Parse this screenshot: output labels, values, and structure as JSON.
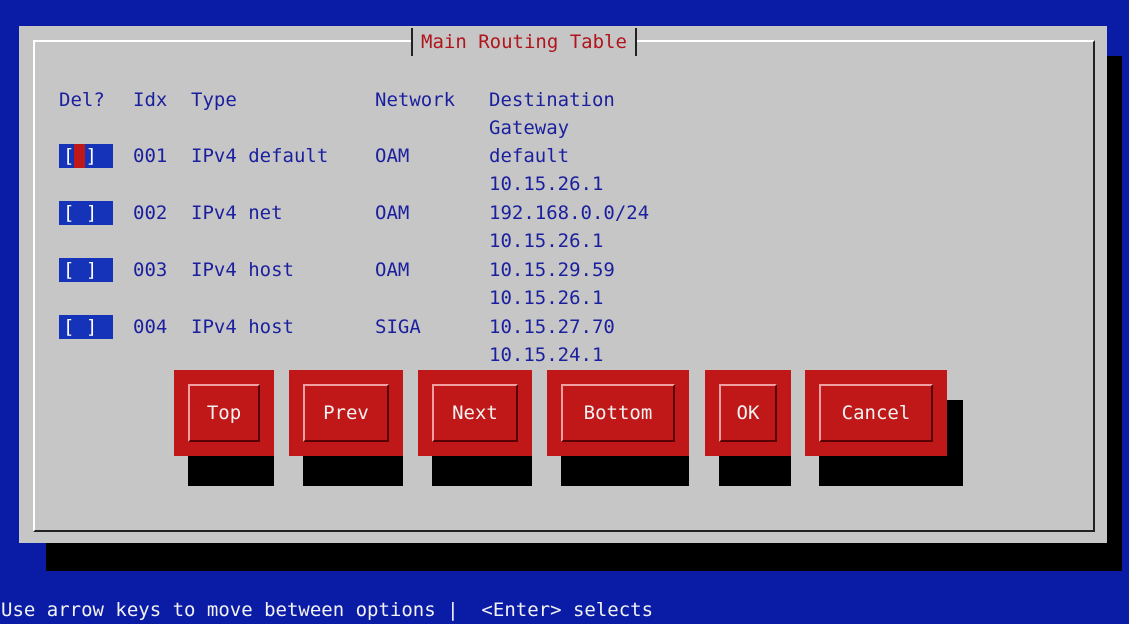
{
  "dialog": {
    "title": "Main Routing Table"
  },
  "columns": {
    "del": "Del?",
    "idx": "Idx",
    "type": "Type",
    "network": "Network",
    "destination": "Destination",
    "gateway": "Gateway"
  },
  "rows": [
    {
      "checkbox": "[ ]",
      "idx": "001",
      "type": "IPv4 default",
      "network": "OAM",
      "destination": "default",
      "gateway": "10.15.26.1",
      "focused": true
    },
    {
      "checkbox": "[ ]",
      "idx": "002",
      "type": "IPv4 net",
      "network": "OAM",
      "destination": "192.168.0.0/24",
      "gateway": "10.15.26.1",
      "focused": false
    },
    {
      "checkbox": "[ ]",
      "idx": "003",
      "type": "IPv4 host",
      "network": "OAM",
      "destination": "10.15.29.59",
      "gateway": "10.15.26.1",
      "focused": false
    },
    {
      "checkbox": "[ ]",
      "idx": "004",
      "type": "IPv4 host",
      "network": "SIGA",
      "destination": "10.15.27.70",
      "gateway": "10.15.24.1",
      "focused": false
    }
  ],
  "buttons": {
    "top": "Top",
    "prev": "Prev",
    "next": "Next",
    "bottom": "Bottom",
    "ok": "OK",
    "cancel": "Cancel"
  },
  "footer": {
    "hint": "Use arrow keys to move between options |  <Enter> selects"
  },
  "colors": {
    "screen_background": "#0a1ca6",
    "dialog_background": "#c6c6c6",
    "title_text": "#b0141c",
    "body_text": "#1a1f9e",
    "button_background": "#c01818",
    "checkbox_background": "#1533b8",
    "shadow": "#000000"
  }
}
